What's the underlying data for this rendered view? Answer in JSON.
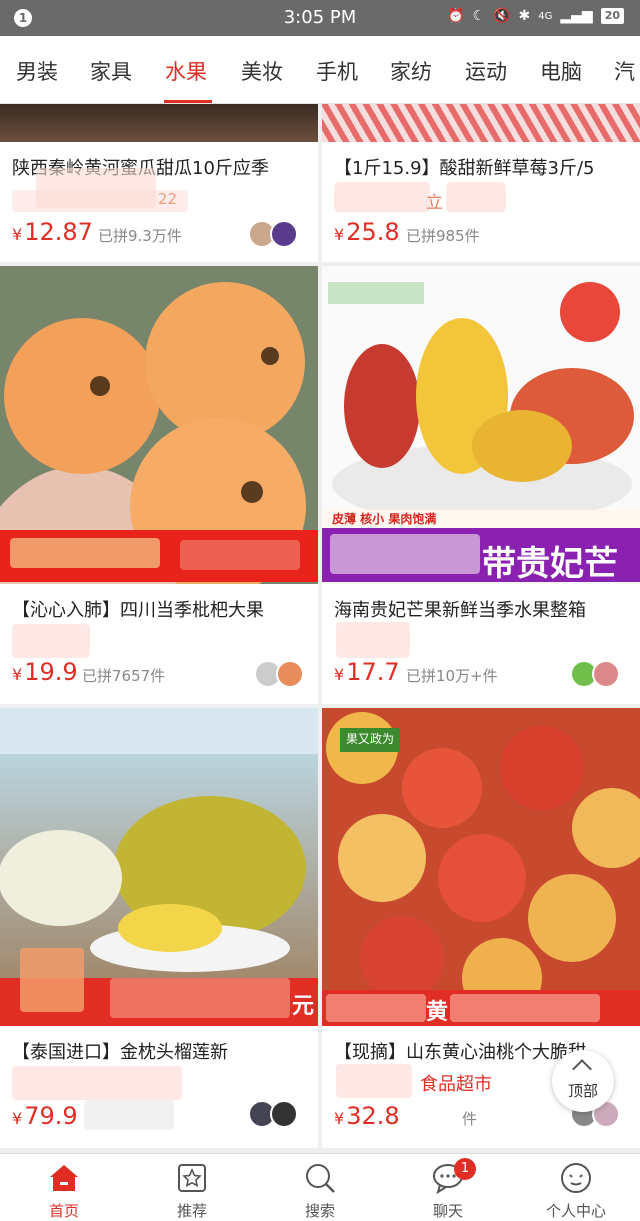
{
  "status_bar": {
    "notification": "1",
    "time": "3:05 PM",
    "network": "4G",
    "battery": "20"
  },
  "tabs": [
    "男装",
    "家具",
    "水果",
    "美妆",
    "手机",
    "家纺",
    "运动",
    "电脑",
    "汽"
  ],
  "active_tab": "水果",
  "products": [
    {
      "title": "陕西秦岭黄河蜜瓜甜瓜10斤应季",
      "tag_fragment": "22",
      "price_symbol": "¥",
      "price": "12.87",
      "sold": "已拼9.3万件"
    },
    {
      "title": "【1斤15.9】酸甜新鲜草莓3斤/5",
      "tag_fragment": "立",
      "price_symbol": "¥",
      "price": "25.8",
      "sold": "已拼985件"
    },
    {
      "title": "【沁心入肺】四川当季枇杷大果",
      "price_symbol": "¥",
      "price": "19.9",
      "sold": "已拼7657件",
      "banner_text": ""
    },
    {
      "title": "海南贵妃芒果新鲜当季水果整箱",
      "price_symbol": "¥",
      "price": "17.7",
      "sold": "已拼10万+件",
      "banner_text": "带贵妃芒",
      "banner_sub": "皮薄  核小  果肉饱满"
    },
    {
      "title": "【泰国进口】金枕头榴莲新",
      "price_symbol": "¥",
      "price": "79.9",
      "sold": "",
      "banner_text": "元"
    },
    {
      "title": "【现摘】山东黄心油桃个大脆甜",
      "price_symbol": "¥",
      "price": "32.8",
      "sold": "件",
      "badge_text": "果又政为",
      "banner_text": "黄"
    }
  ],
  "overlay": {
    "food_supermarket": "食品超市",
    "top_button": "顶部"
  },
  "bottom_nav": [
    {
      "label": "首页",
      "icon": "home-icon"
    },
    {
      "label": "推荐",
      "icon": "recommend-star-icon"
    },
    {
      "label": "搜索",
      "icon": "search-icon"
    },
    {
      "label": "聊天",
      "icon": "chat-icon",
      "badge": "1"
    },
    {
      "label": "个人中心",
      "icon": "profile-icon"
    }
  ],
  "colors": {
    "accent": "#e02e24",
    "status_bar": "#6a6a6a"
  }
}
